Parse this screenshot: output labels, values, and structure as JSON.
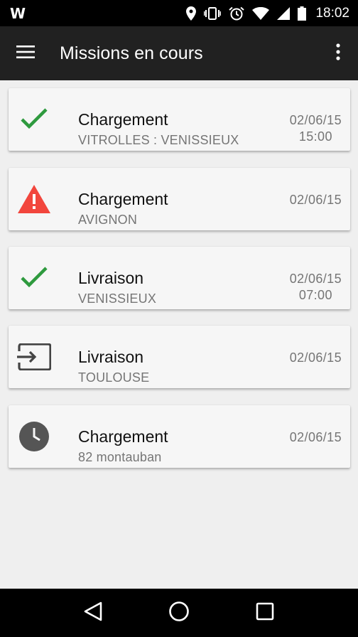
{
  "status_bar": {
    "logo": "W",
    "time": "18:02",
    "icons": [
      "location-icon",
      "vibrate-icon",
      "alarm-icon",
      "wifi-icon",
      "signal-icon",
      "battery-icon"
    ]
  },
  "app_bar": {
    "title": "Missions en cours",
    "menu_icon": "menu-icon",
    "overflow_icon": "more-vert-icon"
  },
  "missions": [
    {
      "title": "Chargement",
      "subtitle": "VITROLLES : VENISSIEUX",
      "date": "02/06/15",
      "time": "15:00",
      "status_icon": "check-icon",
      "status_color": "#2e9a3e"
    },
    {
      "title": "Chargement",
      "subtitle": "AVIGNON",
      "date": "02/06/15",
      "time": "",
      "status_icon": "warning-icon",
      "status_color": "#f2463d"
    },
    {
      "title": "Livraison",
      "subtitle": "VENISSIEUX",
      "date": "02/06/15",
      "time": "07:00",
      "status_icon": "check-icon",
      "status_color": "#2e9a3e"
    },
    {
      "title": "Livraison",
      "subtitle": "TOULOUSE",
      "date": "02/06/15",
      "time": "",
      "status_icon": "input-icon",
      "status_color": "#444444"
    },
    {
      "title": "Chargement",
      "subtitle": "82 montauban",
      "date": "02/06/15",
      "time": "",
      "status_icon": "clock-icon",
      "status_color": "#555555"
    }
  ],
  "nav_bar": {
    "icons": [
      "back-icon",
      "home-icon",
      "recents-icon"
    ]
  }
}
